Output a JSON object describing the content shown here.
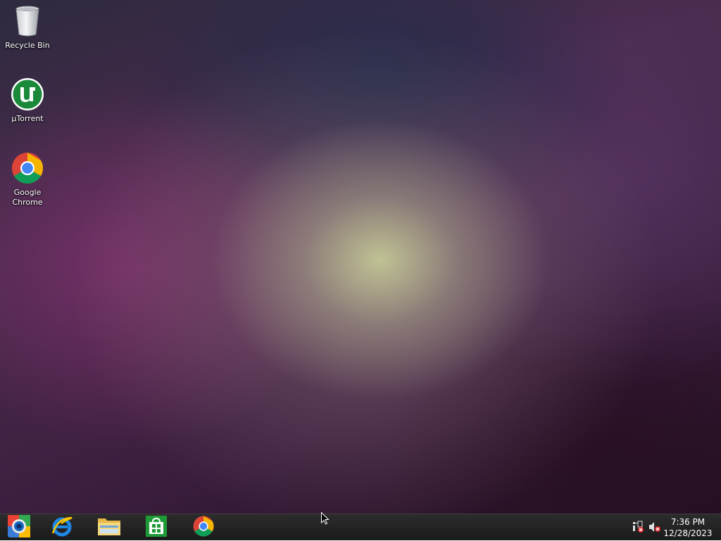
{
  "desktop": {
    "icons": [
      {
        "label": "Recycle Bin",
        "icon": "recycle-bin-icon"
      },
      {
        "label": "µTorrent",
        "icon": "utorrent-icon"
      },
      {
        "label": "Google Chrome",
        "icon": "google-chrome-icon"
      }
    ]
  },
  "taskbar": {
    "pinned": [
      {
        "name": "start-button",
        "icon": "start-orb-icon"
      },
      {
        "name": "internet-explorer",
        "icon": "internet-explorer-icon"
      },
      {
        "name": "file-explorer",
        "icon": "file-explorer-icon"
      },
      {
        "name": "windows-store",
        "icon": "windows-store-icon"
      },
      {
        "name": "google-chrome",
        "icon": "google-chrome-icon"
      }
    ],
    "tray": {
      "network_status": "disconnected",
      "volume_status": "muted"
    },
    "clock": {
      "time": "7:36 PM",
      "date": "12/28/2023"
    }
  },
  "colors": {
    "taskbar_bg": "#1f1f1f",
    "utorrent_green": "#1a8a3a",
    "store_green": "#1e9b36",
    "alert_red": "#e02020"
  }
}
